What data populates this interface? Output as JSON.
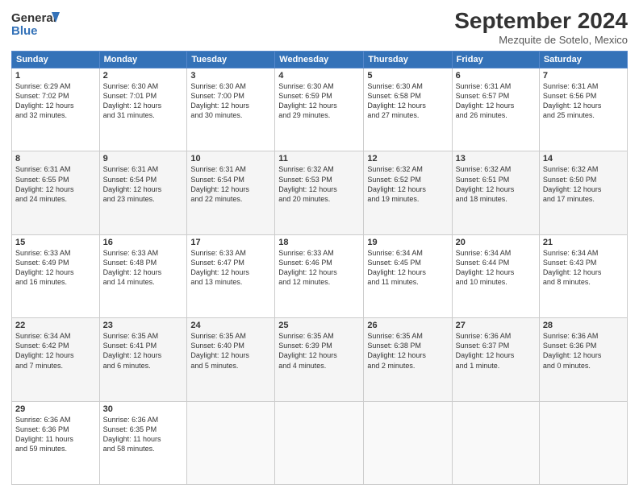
{
  "header": {
    "logo_line1": "General",
    "logo_line2": "Blue",
    "month": "September 2024",
    "location": "Mezquite de Sotelo, Mexico"
  },
  "weekdays": [
    "Sunday",
    "Monday",
    "Tuesday",
    "Wednesday",
    "Thursday",
    "Friday",
    "Saturday"
  ],
  "weeks": [
    [
      {
        "day": "1",
        "info": "Sunrise: 6:29 AM\nSunset: 7:02 PM\nDaylight: 12 hours\nand 32 minutes."
      },
      {
        "day": "2",
        "info": "Sunrise: 6:30 AM\nSunset: 7:01 PM\nDaylight: 12 hours\nand 31 minutes."
      },
      {
        "day": "3",
        "info": "Sunrise: 6:30 AM\nSunset: 7:00 PM\nDaylight: 12 hours\nand 30 minutes."
      },
      {
        "day": "4",
        "info": "Sunrise: 6:30 AM\nSunset: 6:59 PM\nDaylight: 12 hours\nand 29 minutes."
      },
      {
        "day": "5",
        "info": "Sunrise: 6:30 AM\nSunset: 6:58 PM\nDaylight: 12 hours\nand 27 minutes."
      },
      {
        "day": "6",
        "info": "Sunrise: 6:31 AM\nSunset: 6:57 PM\nDaylight: 12 hours\nand 26 minutes."
      },
      {
        "day": "7",
        "info": "Sunrise: 6:31 AM\nSunset: 6:56 PM\nDaylight: 12 hours\nand 25 minutes."
      }
    ],
    [
      {
        "day": "8",
        "info": "Sunrise: 6:31 AM\nSunset: 6:55 PM\nDaylight: 12 hours\nand 24 minutes."
      },
      {
        "day": "9",
        "info": "Sunrise: 6:31 AM\nSunset: 6:54 PM\nDaylight: 12 hours\nand 23 minutes."
      },
      {
        "day": "10",
        "info": "Sunrise: 6:31 AM\nSunset: 6:54 PM\nDaylight: 12 hours\nand 22 minutes."
      },
      {
        "day": "11",
        "info": "Sunrise: 6:32 AM\nSunset: 6:53 PM\nDaylight: 12 hours\nand 20 minutes."
      },
      {
        "day": "12",
        "info": "Sunrise: 6:32 AM\nSunset: 6:52 PM\nDaylight: 12 hours\nand 19 minutes."
      },
      {
        "day": "13",
        "info": "Sunrise: 6:32 AM\nSunset: 6:51 PM\nDaylight: 12 hours\nand 18 minutes."
      },
      {
        "day": "14",
        "info": "Sunrise: 6:32 AM\nSunset: 6:50 PM\nDaylight: 12 hours\nand 17 minutes."
      }
    ],
    [
      {
        "day": "15",
        "info": "Sunrise: 6:33 AM\nSunset: 6:49 PM\nDaylight: 12 hours\nand 16 minutes."
      },
      {
        "day": "16",
        "info": "Sunrise: 6:33 AM\nSunset: 6:48 PM\nDaylight: 12 hours\nand 14 minutes."
      },
      {
        "day": "17",
        "info": "Sunrise: 6:33 AM\nSunset: 6:47 PM\nDaylight: 12 hours\nand 13 minutes."
      },
      {
        "day": "18",
        "info": "Sunrise: 6:33 AM\nSunset: 6:46 PM\nDaylight: 12 hours\nand 12 minutes."
      },
      {
        "day": "19",
        "info": "Sunrise: 6:34 AM\nSunset: 6:45 PM\nDaylight: 12 hours\nand 11 minutes."
      },
      {
        "day": "20",
        "info": "Sunrise: 6:34 AM\nSunset: 6:44 PM\nDaylight: 12 hours\nand 10 minutes."
      },
      {
        "day": "21",
        "info": "Sunrise: 6:34 AM\nSunset: 6:43 PM\nDaylight: 12 hours\nand 8 minutes."
      }
    ],
    [
      {
        "day": "22",
        "info": "Sunrise: 6:34 AM\nSunset: 6:42 PM\nDaylight: 12 hours\nand 7 minutes."
      },
      {
        "day": "23",
        "info": "Sunrise: 6:35 AM\nSunset: 6:41 PM\nDaylight: 12 hours\nand 6 minutes."
      },
      {
        "day": "24",
        "info": "Sunrise: 6:35 AM\nSunset: 6:40 PM\nDaylight: 12 hours\nand 5 minutes."
      },
      {
        "day": "25",
        "info": "Sunrise: 6:35 AM\nSunset: 6:39 PM\nDaylight: 12 hours\nand 4 minutes."
      },
      {
        "day": "26",
        "info": "Sunrise: 6:35 AM\nSunset: 6:38 PM\nDaylight: 12 hours\nand 2 minutes."
      },
      {
        "day": "27",
        "info": "Sunrise: 6:36 AM\nSunset: 6:37 PM\nDaylight: 12 hours\nand 1 minute."
      },
      {
        "day": "28",
        "info": "Sunrise: 6:36 AM\nSunset: 6:36 PM\nDaylight: 12 hours\nand 0 minutes."
      }
    ],
    [
      {
        "day": "29",
        "info": "Sunrise: 6:36 AM\nSunset: 6:36 PM\nDaylight: 11 hours\nand 59 minutes."
      },
      {
        "day": "30",
        "info": "Sunrise: 6:36 AM\nSunset: 6:35 PM\nDaylight: 11 hours\nand 58 minutes."
      },
      {
        "day": "",
        "info": ""
      },
      {
        "day": "",
        "info": ""
      },
      {
        "day": "",
        "info": ""
      },
      {
        "day": "",
        "info": ""
      },
      {
        "day": "",
        "info": ""
      }
    ]
  ]
}
